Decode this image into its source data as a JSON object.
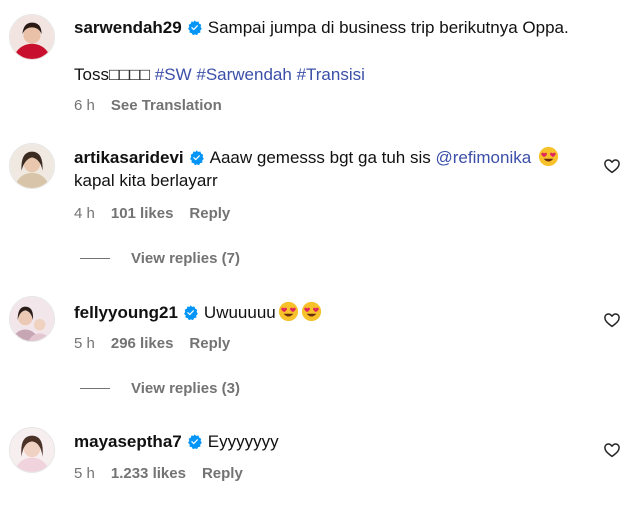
{
  "caption": {
    "username": "sarwendah29",
    "text": "Sampai jumpa di business trip berikutnya Oppa.",
    "toss_prefix": "Toss",
    "toss_boxes": "□□□□",
    "hashtags": [
      "#SW",
      "#Sarwendah",
      "#Transisi"
    ],
    "time": "6 h",
    "see_translation": "See Translation"
  },
  "comments": [
    {
      "username": "artikasaridevi",
      "text": "Aaaw gemesss bgt ga tuh sis",
      "mention": "@refimonika",
      "emoji": "smiling-face-with-heart-eyes",
      "text_line2": "kapal kita berlayarr",
      "time": "4 h",
      "likes": "101 likes",
      "reply": "Reply",
      "view_replies": "View replies (7)"
    },
    {
      "username": "fellyyoung21",
      "text": "Uwuuuuu",
      "emoji": "smiling-face-with-heart-eyes",
      "time": "5 h",
      "likes": "296 likes",
      "reply": "Reply",
      "view_replies": "View replies (3)"
    },
    {
      "username": "mayaseptha7",
      "text": "Eyyyyyyy",
      "time": "5 h",
      "likes": "1.233 likes",
      "reply": "Reply"
    }
  ],
  "colors": {
    "verified": "#0095f6",
    "link": "#3b4fa8",
    "muted": "#737373"
  }
}
